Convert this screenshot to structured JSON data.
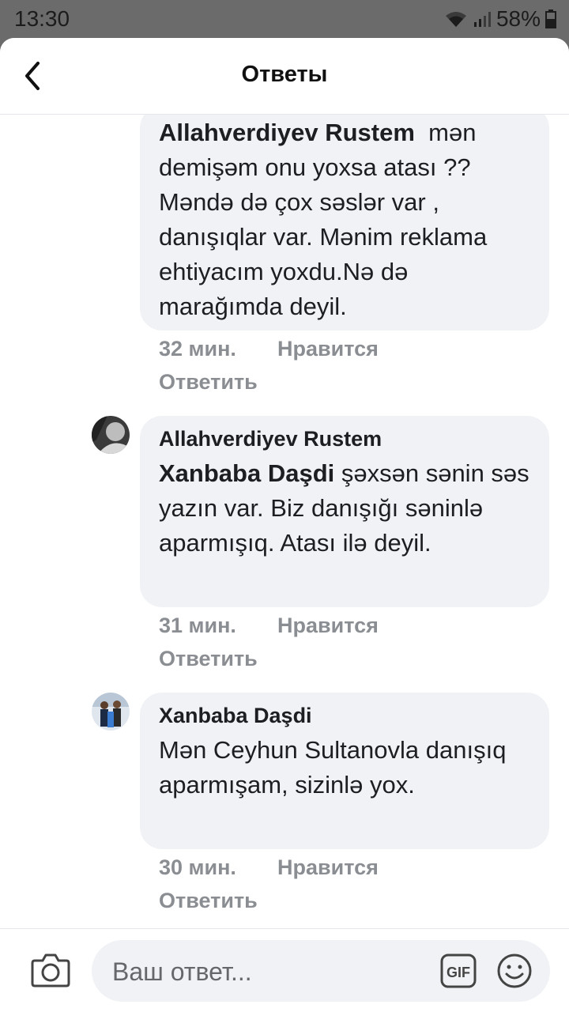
{
  "status": {
    "time": "13:30",
    "battery": "58%"
  },
  "header": {
    "title": "Ответы"
  },
  "comments": [
    {
      "author": "Allahverdiyev Rustem",
      "text": "mən demişəm onu yoxsa atası ?? Məndə də çox səslər var , danışıqlar var. Mənim reklama ehtiyacım yoxdu.Nə də marağımda deyil.",
      "time": "32 мин.",
      "like": "Нравится",
      "reply": "Ответить"
    },
    {
      "author": "Allahverdiyev Rustem",
      "mention": "Xanbaba Daşdi",
      "text": " şəxsən sənin səs yazın var. Biz danışığı səninlə aparmışıq. Atası ilə deyil.",
      "time": "31 мин.",
      "like": "Нравится",
      "reply": "Ответить"
    },
    {
      "author": "Xanbaba Daşdi",
      "text": "Mən Ceyhun Sultanovla danışıq aparmışam, sizinlə yox.",
      "time": "30 мин.",
      "like": "Нравится",
      "reply": "Ответить"
    }
  ],
  "composer": {
    "placeholder": "Ваш ответ...",
    "gif_label": "GIF"
  },
  "icons": {
    "back": "chevron-left-icon",
    "camera": "camera-icon",
    "gif": "gif-icon",
    "emoji": "emoji-icon",
    "wifi": "wifi-icon",
    "signal": "signal-icon",
    "battery": "battery-icon"
  },
  "colors": {
    "bubble": "#f0f2f5",
    "meta": "#8a8d91",
    "statusbar": "#6b6b6b"
  }
}
